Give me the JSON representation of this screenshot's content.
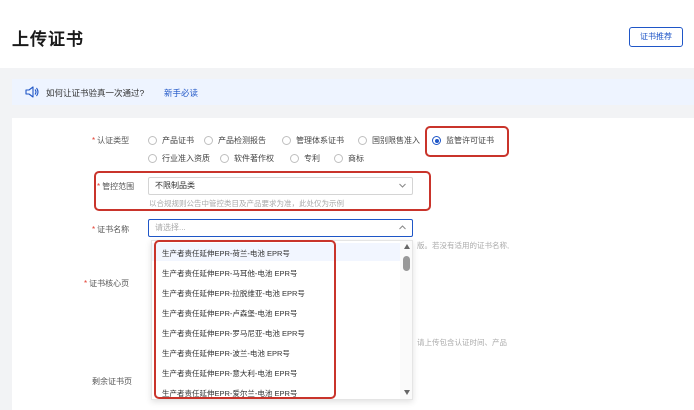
{
  "header": {
    "title": "上传证书",
    "recommend_button": "证书推荐"
  },
  "notice": {
    "question": "如何让证书验真一次通过?",
    "link": "新手必读"
  },
  "form": {
    "cert_type": {
      "label": "认证类型",
      "options": [
        "产品证书",
        "产品检测报告",
        "管理体系证书",
        "国别限售准入",
        "监管许可证书",
        "行业准入资质",
        "软件著作权",
        "专利",
        "商标"
      ],
      "selected": "监管许可证书"
    },
    "control_scope": {
      "label": "管控范围",
      "value": "不限制品类",
      "hint": "以合规规则公告中管控类目及产品要求为准，此处仅为示例"
    },
    "cert_name": {
      "label": "证书名称",
      "placeholder": "请选择...",
      "side_hint": "版。若没有适用的证书名称,"
    },
    "cert_core_page": {
      "label": "证书核心页",
      "side_hint": "请上传包含认证时间、产品"
    },
    "remaining_pages": {
      "label": "剩余证书页"
    }
  },
  "dropdown": {
    "options": [
      "生产者责任延伸EPR-荷兰-电池 EPR号",
      "生产者责任延伸EPR-马耳他-电池 EPR号",
      "生产者责任延伸EPR-拉脱维亚-电池 EPR号",
      "生产者责任延伸EPR-卢森堡-电池 EPR号",
      "生产者责任延伸EPR-罗马尼亚-电池 EPR号",
      "生产者责任延伸EPR-波兰-电池 EPR号",
      "生产者责任延伸EPR-意大利-电池 EPR号",
      "生产者责任延伸EPR-爱尔兰-电池 EPR号"
    ]
  },
  "colors": {
    "accent": "#1f56c7",
    "highlight_box": "#c9342b",
    "required": "#e23c2e"
  }
}
